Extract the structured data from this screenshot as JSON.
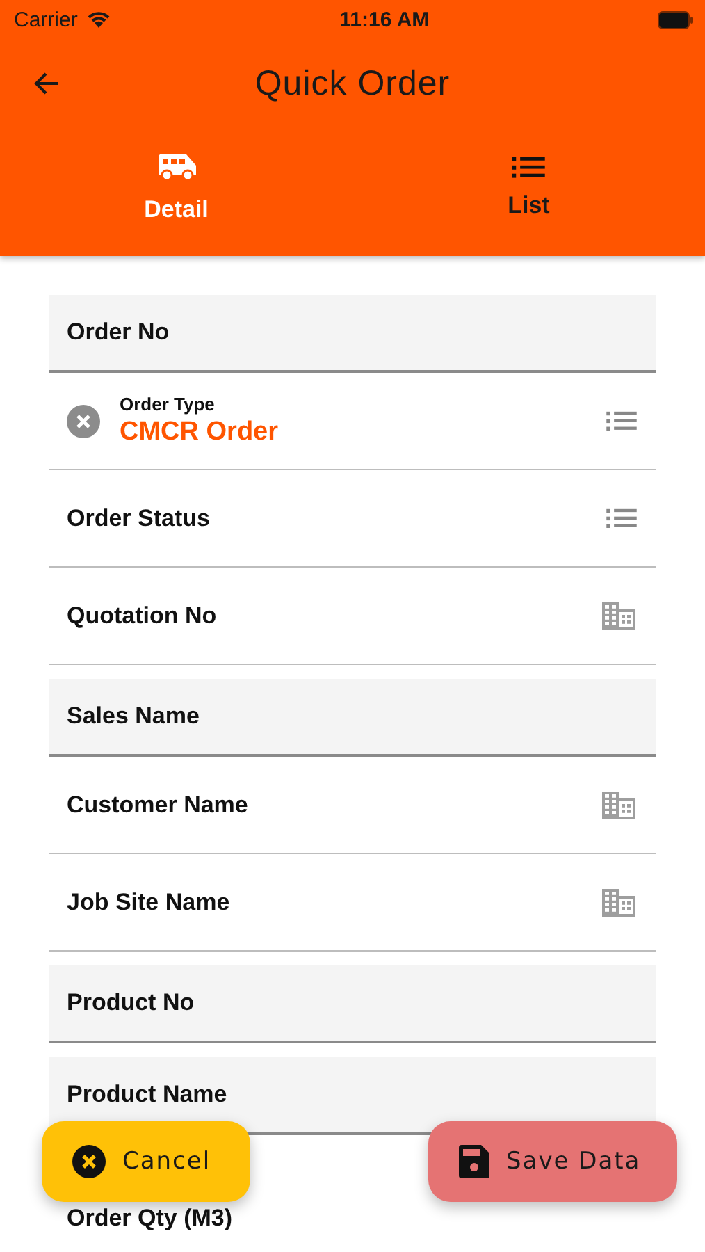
{
  "status_bar": {
    "carrier": "Carrier",
    "time": "11:16 AM"
  },
  "header": {
    "title": "Quick Order"
  },
  "tabs": [
    {
      "label": "Detail",
      "kind": "detail",
      "selected": true
    },
    {
      "label": "List",
      "kind": "list",
      "selected": false
    }
  ],
  "fields": [
    {
      "kind": "text",
      "label": "Order No"
    },
    {
      "kind": "list",
      "label": "Order Type",
      "value": "CMCR Order",
      "clearable": true
    },
    {
      "kind": "list",
      "label": "Order Status"
    },
    {
      "kind": "lookup",
      "label": "Quotation No"
    },
    {
      "kind": "text",
      "label": "Sales Name"
    },
    {
      "kind": "lookup",
      "label": "Customer Name"
    },
    {
      "kind": "lookup",
      "label": "Job Site Name"
    },
    {
      "kind": "text",
      "label": "Product No"
    },
    {
      "kind": "text",
      "label": "Product Name"
    },
    {
      "kind": "plain",
      "label": "Order Qty (M3)"
    }
  ],
  "actions": [
    {
      "kind": "cancel",
      "label": "Cancel"
    },
    {
      "kind": "save",
      "label": "Save Data"
    }
  ]
}
